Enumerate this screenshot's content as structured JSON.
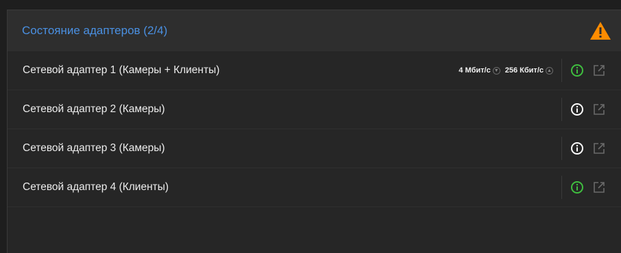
{
  "panel": {
    "title": "Состояние адаптеров (2/4)",
    "warning_icon": "warning-triangle-icon",
    "accent_color": "#4a90e2",
    "warning_color": "#ff8c00"
  },
  "adapters": [
    {
      "label": "Сетевой адаптер 1 (Камеры + Клиенты)",
      "download": "4 Мбит/с",
      "upload": "256 Кбит/с",
      "status_color": "#3fbf3f"
    },
    {
      "label": "Сетевой адаптер 2 (Камеры)",
      "status_color": "#ffffff"
    },
    {
      "label": "Сетевой адаптер 3 (Камеры)",
      "status_color": "#ffffff"
    },
    {
      "label": "Сетевой адаптер 4 (Клиенты)",
      "status_color": "#3fbf3f"
    }
  ]
}
